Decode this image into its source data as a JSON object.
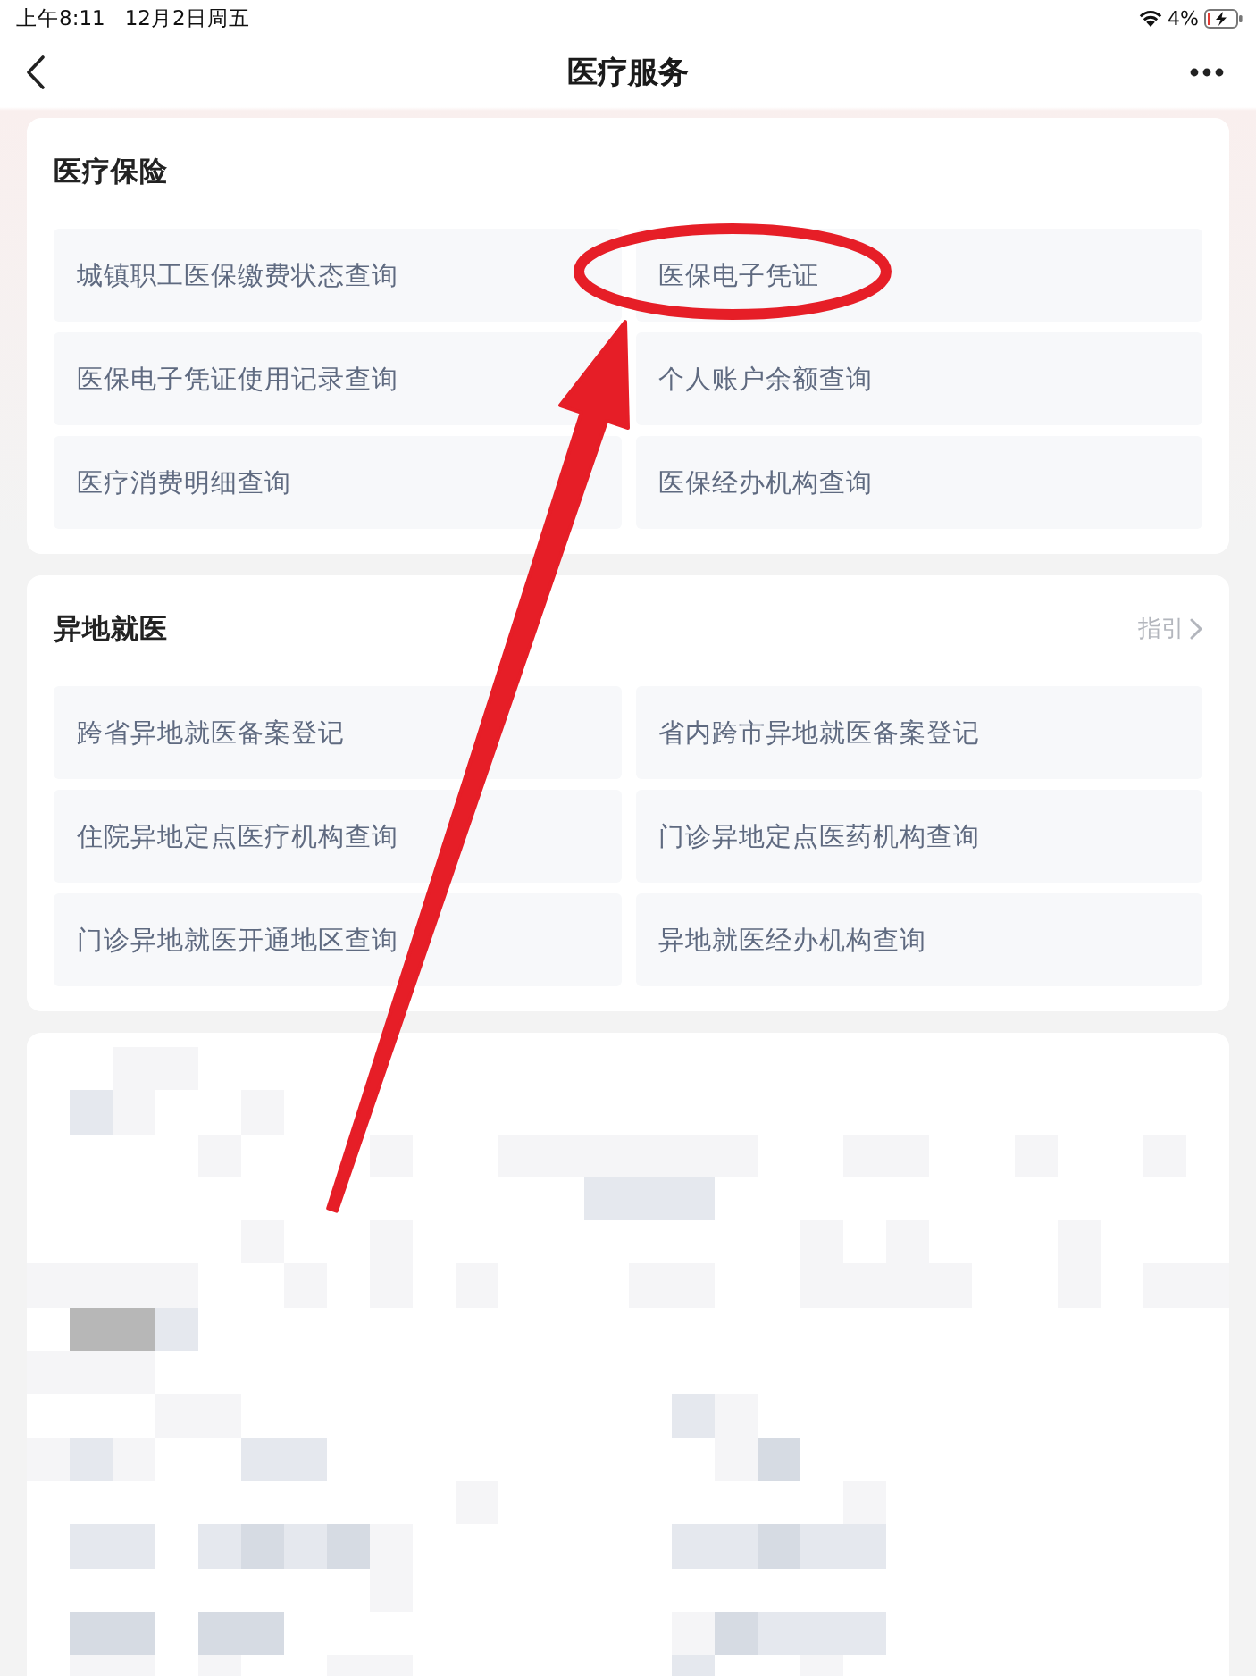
{
  "status_bar": {
    "time": "上午8:11",
    "date": "12月2日周五",
    "battery": "4%"
  },
  "nav_bar": {
    "title": "医疗服务"
  },
  "sections": [
    {
      "title": "医疗保险",
      "items": [
        "城镇职工医保缴费状态查询",
        "医保电子凭证",
        "医保电子凭证使用记录查询",
        "个人账户余额查询",
        "医疗消费明细查询",
        "医保经办机构查询"
      ]
    },
    {
      "title": "异地就医",
      "link": "指引",
      "items": [
        "跨省异地就医备案登记",
        "省内跨市异地就医备案登记",
        "住院异地定点医疗机构查询",
        "门诊异地定点医药机构查询",
        "门诊异地就医开通地区查询",
        "异地就医经办机构查询"
      ]
    }
  ]
}
